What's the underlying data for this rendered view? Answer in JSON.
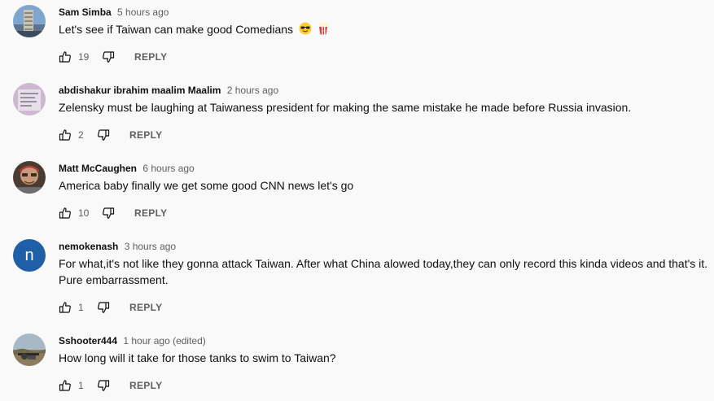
{
  "comments": [
    {
      "author": "Sam Simba",
      "time": "5 hours ago",
      "text": "Let's see if Taiwan can make good Comedians",
      "emoji": [
        "smiling-face-with-sunglasses",
        "popcorn"
      ],
      "likes": "19",
      "reply_label": "REPLY",
      "avatar": "tower-photo-avatar"
    },
    {
      "author": "abdishakur ibrahim maalim Maalim",
      "time": "2 hours ago",
      "text": "Zelensky must be laughing at Taiwaness president for making the same mistake he made before Russia invasion.",
      "likes": "2",
      "reply_label": "REPLY",
      "avatar": "document-photo-avatar"
    },
    {
      "author": "Matt McCaughen",
      "time": "6 hours ago",
      "text": "America baby finally we get some good CNN news let's go",
      "likes": "10",
      "reply_label": "REPLY",
      "avatar": "person-photo-avatar"
    },
    {
      "author": "nemokenash",
      "time": "3 hours ago",
      "text": "For what,it's not like they gonna attack Taiwan. After what China alowed today,they can only record this kinda videos and that's it. Pure embarrassment.",
      "likes": "1",
      "reply_label": "REPLY",
      "avatar_letter": "n",
      "avatar_color": "#1f5fa8"
    },
    {
      "author": "Sshooter444",
      "time": "1 hour ago (edited)",
      "text": "How long will it take for those tanks to swim to Taiwan?",
      "likes": "1",
      "reply_label": "REPLY",
      "avatar": "landscape-photo-avatar"
    }
  ],
  "icons": {
    "like": "thumbs-up-icon",
    "dislike": "thumbs-down-icon"
  },
  "colors": {
    "background": "#f9f9f9",
    "text": "#0f0f0f",
    "secondary": "#606060"
  }
}
